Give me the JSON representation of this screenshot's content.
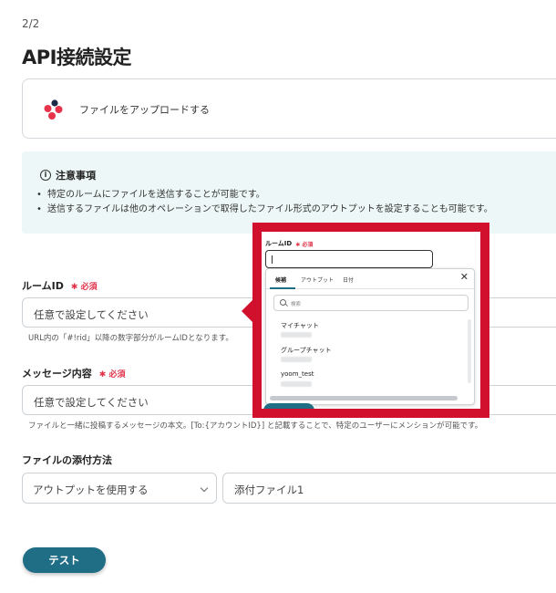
{
  "header": {
    "step": "2/2",
    "title": "API接続設定"
  },
  "app_card": {
    "label": "ファイルをアップロードする",
    "logo_icon": "chatwork-logo"
  },
  "notice": {
    "title": "注意事項",
    "items": [
      "特定のルームにファイルを送信することが可能です。",
      "送信するファイルは他のオペレーションで取得したファイル形式のアウトプットを設定することも可能です。"
    ]
  },
  "room_id": {
    "label": "ルームID",
    "required": "必須",
    "placeholder": "任意で設定してください",
    "hint": "URL内の「#!rid」以降の数字部分がルームIDとなります。"
  },
  "message": {
    "label": "メッセージ内容",
    "required": "必須",
    "placeholder": "任意で設定してください",
    "hint": "ファイルと一緒に投稿するメッセージの本文。[To:{アカウントID}] と記載することで、特定のユーザーにメンションが可能です。"
  },
  "attach": {
    "label": "ファイルの添付方法",
    "method_value": "アウトプットを使用する",
    "file_value": "添付ファイル1"
  },
  "test_button": "テスト",
  "popup": {
    "label": "ルームID",
    "required": "必須",
    "tabs": [
      "候補",
      "アウトプット",
      "日付"
    ],
    "search_placeholder": "検索",
    "items": [
      "マイチャット",
      "グループチャット",
      "yoom_test"
    ],
    "accent_color": "#d0102d"
  }
}
